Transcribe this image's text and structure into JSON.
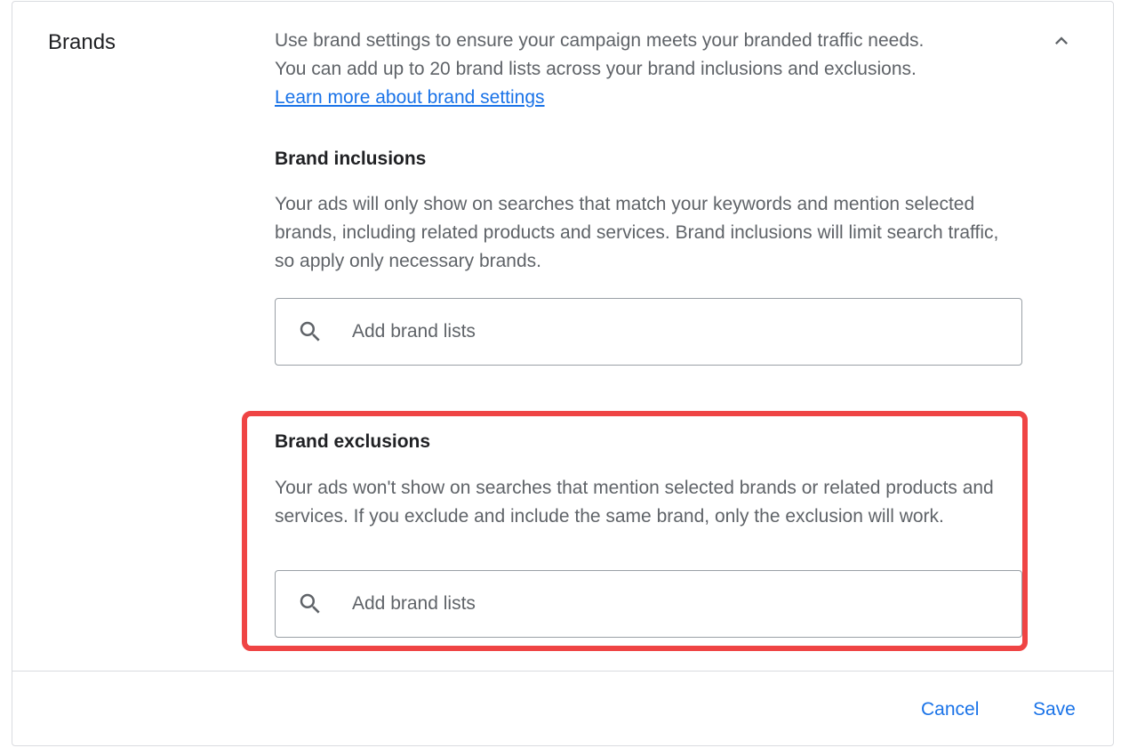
{
  "section": {
    "title": "Brands",
    "collapse_icon": "chevron-up-icon"
  },
  "intro": {
    "line1": "Use brand settings to ensure your campaign meets your branded traffic needs.",
    "line2": "You can add up to 20 brand lists across your brand inclusions and exclusions.",
    "learn_more": "Learn more about brand settings"
  },
  "inclusions": {
    "title": "Brand inclusions",
    "description": "Your ads will only show on searches that match your keywords and mention selected brands, including related products and services. Brand inclusions will limit search traffic, so apply only necessary brands.",
    "search_icon": "search-icon",
    "placeholder": "Add brand lists",
    "value": ""
  },
  "exclusions": {
    "title": "Brand exclusions",
    "description": "Your ads won't show on searches that mention selected brands or related products and services. If you exclude and include the same brand, only the exclusion will work.",
    "search_icon": "search-icon",
    "placeholder": "Add brand lists",
    "value": "",
    "highlight_color": "#ef4444"
  },
  "footer": {
    "cancel_label": "Cancel",
    "save_label": "Save"
  },
  "colors": {
    "accent": "#1a73e8",
    "text_primary": "#202124",
    "text_secondary": "#5f6368",
    "border": "#dadce0",
    "highlight": "#ef4444"
  }
}
